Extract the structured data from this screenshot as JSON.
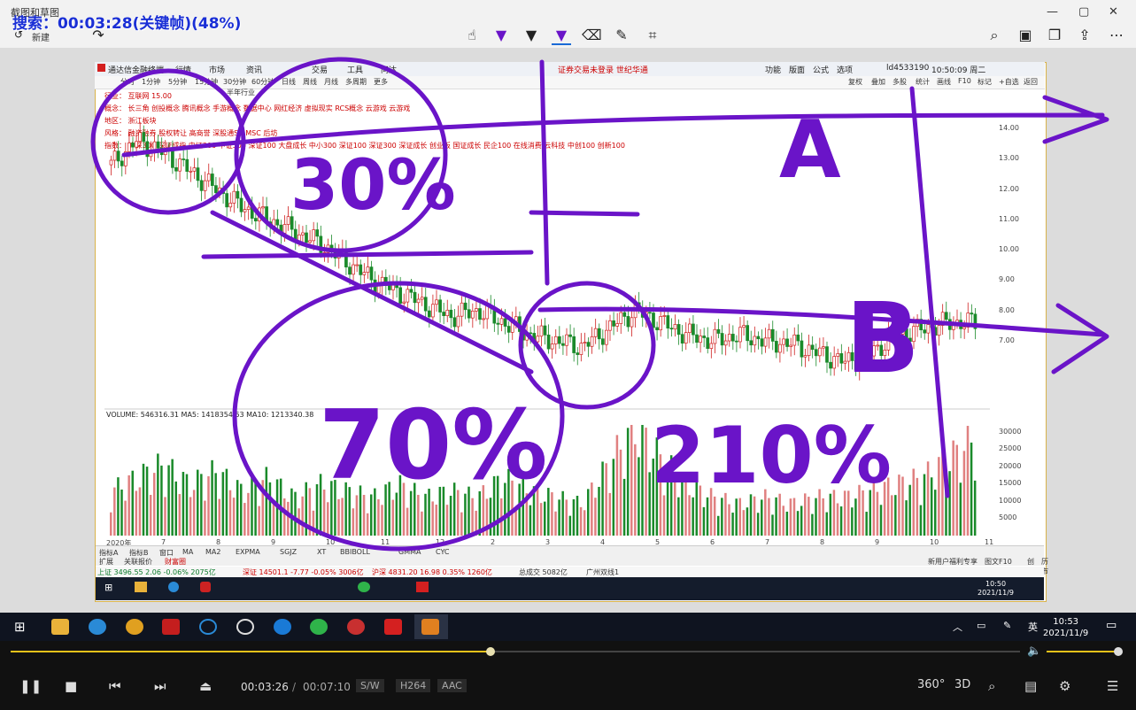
{
  "viewer": {
    "title": "截图和草图",
    "capture_status": "搜索：00:03:28(关键帧)(48%)",
    "new_label": "新建",
    "window_controls": [
      "—",
      "▢",
      "✕"
    ]
  },
  "app": {
    "name": "通达信金融终端",
    "menus": [
      "行情",
      "市场",
      "资讯",
      "交易",
      "工具",
      "问达"
    ],
    "promo": "证券交易未登录   世纪华通",
    "right_menus": [
      "功能",
      "版面",
      "公式",
      "选项"
    ],
    "account": "ld4533190",
    "time": "10:50:09 周二",
    "periods": [
      "分时",
      "1分钟",
      "5分钟",
      "15分钟",
      "30分钟",
      "60分钟",
      "日线",
      "周线",
      "月线",
      "多周期",
      "更多"
    ],
    "right_tools": [
      "复权",
      "叠加",
      "多股",
      "统计",
      "画线",
      "F10",
      "标记",
      "+自选",
      "返回"
    ],
    "info_lines": [
      "行业：   互联网  15.00",
      "概念：   长三角 创投概念 腾讯概念 手游概念 数据中心 网红经济 虚拟现实 RCS概念 云游戏 云游戏",
      "地区：   浙江板块",
      "风格：   融资融券 股权转让 高商誉 深股通SZ MSC 后坊",
      "指数：   沪深300 深证成指 中证200 中证500 深证100 大盘成长 中小300 深证100 深证300 深证成长 创业板 国证成长 民企100 在线消费 云科技 中创100 创新100"
    ],
    "tag_label": "半年行业"
  },
  "chart_data": {
    "type": "candlestick",
    "title": "",
    "y_ticks": [
      14.0,
      13.0,
      12.0,
      11.0,
      10.0,
      9.0,
      8.0,
      7.0
    ],
    "vol_ticks": [
      30000,
      25000,
      20000,
      15000,
      10000,
      5000
    ],
    "x_labels": [
      "2020年",
      "7",
      "8",
      "9",
      "10",
      "11",
      "12",
      "2",
      "3",
      "4",
      "5",
      "6",
      "7",
      "8",
      "9",
      "10",
      "11"
    ],
    "volume_legend": "VOLUME: 546316.31  MA5: 1418354.63  MA10: 1213340.38",
    "price_path": [
      12.8,
      13.6,
      13.2,
      12.6,
      12.0,
      11.4,
      11.0,
      10.6,
      10.2,
      9.6,
      9.0,
      8.6,
      8.2,
      7.8,
      8.0,
      7.6,
      7.2,
      7.0,
      6.8,
      7.4,
      8.0,
      7.6,
      7.2,
      7.0,
      7.2,
      7.0,
      6.9,
      6.6,
      6.3,
      6.6,
      7.2,
      7.4,
      7.6,
      7.6
    ],
    "volume_path": [
      0.35,
      0.45,
      0.55,
      0.4,
      0.5,
      0.35,
      0.45,
      0.3,
      0.4,
      0.35,
      0.3,
      0.4,
      0.3,
      0.35,
      0.3,
      0.45,
      0.35,
      0.3,
      0.25,
      0.55,
      0.85,
      0.6,
      0.4,
      0.3,
      0.25,
      0.3,
      0.25,
      0.3,
      0.3,
      0.35,
      0.4,
      0.45,
      0.6,
      0.75
    ]
  },
  "bottom_tabs": [
    "指标A",
    "指标B",
    "窗口",
    "MA",
    "MA2",
    "EXPMA",
    "SGJZ",
    "XT",
    "BBIBOLL",
    "GMMA",
    "CYC"
  ],
  "bottom_tabs2": [
    "扩展",
    "关联报价",
    "财富圈"
  ],
  "right_tabs": [
    "新用户福利专享",
    "图文F10",
    "创",
    "历市"
  ],
  "index_bar": [
    "上证 3496.55  2.06  -0.06%  2075亿",
    "深证 14501.1  -7.77  -0.05%  3006亿",
    "沪深 4831.20  16.98  0.35%  1260亿",
    "总成交 5082亿",
    "广州双线1"
  ],
  "inner_clock": {
    "time": "10:50",
    "date": "2021/11/9"
  },
  "handwriting": {
    "annotation_1": "30%",
    "annotation_2": "70%",
    "annotation_3": "210%",
    "annotation_4": "A",
    "annotation_5": "B"
  },
  "taskbar": {
    "ime": "英",
    "time": "10:53",
    "date": "2021/11/9"
  },
  "player": {
    "current_time": "00:03:26",
    "total_time": "00:07:10",
    "badges": [
      "S/W",
      "H264",
      "AAC"
    ],
    "progress_fraction": 0.475,
    "volume_fraction": 1.0,
    "right_buttons": [
      "360°",
      "3D"
    ]
  },
  "colors": {
    "accent": "#e8c21a",
    "ink": "#6a14c8",
    "status": "#1a2fd6"
  }
}
